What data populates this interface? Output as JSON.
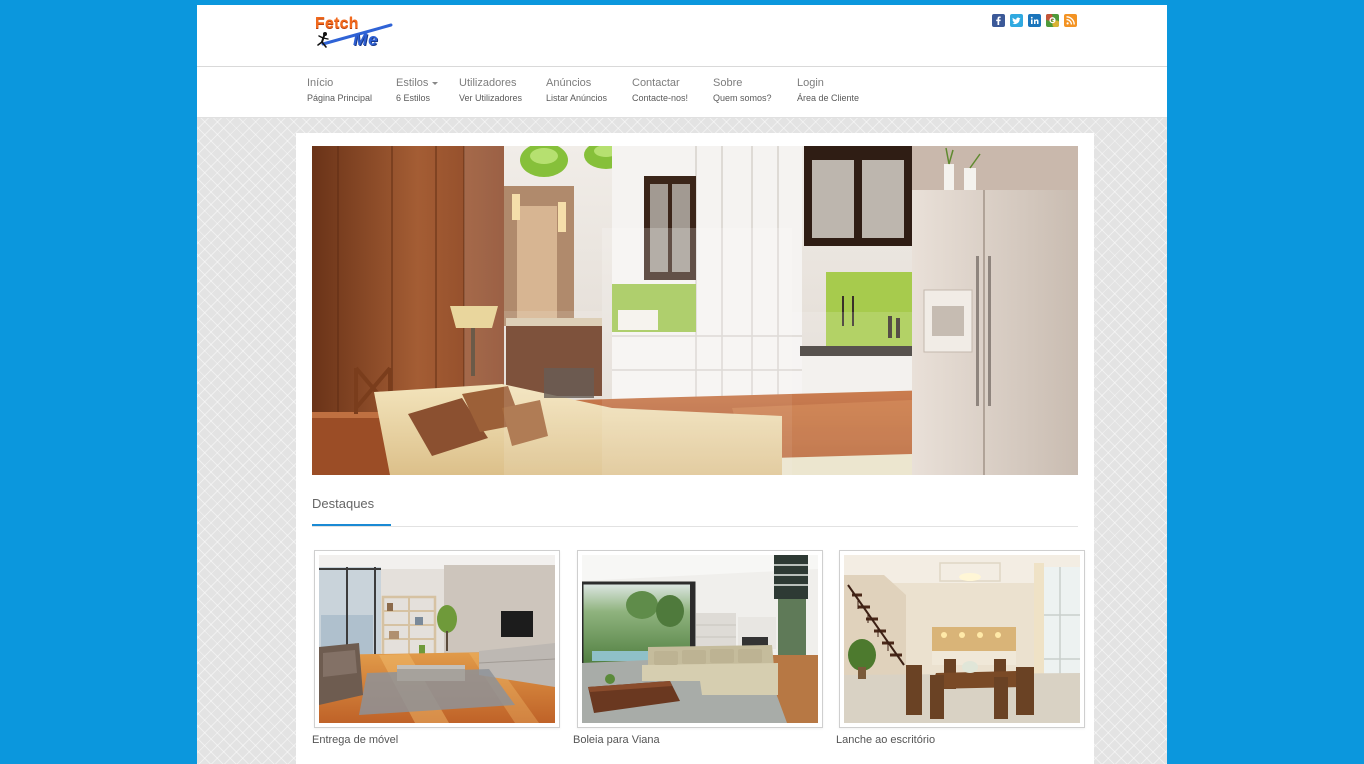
{
  "header": {
    "logo": {
      "word1": "Fetch",
      "word2": "Me"
    },
    "social_icons": [
      "facebook-icon",
      "twitter-icon",
      "linkedin-icon",
      "google-plus-icon",
      "rss-icon"
    ]
  },
  "nav": {
    "items": [
      {
        "label": "Início",
        "sub": "Página Principal"
      },
      {
        "label": "Estilos",
        "sub": "6 Estilos",
        "has_dropdown": true,
        "dropdown_icon": "caret-down-icon"
      },
      {
        "label": "Utilizadores",
        "sub": "Ver Utilizadores"
      },
      {
        "label": "Anúncios",
        "sub": "Listar Anúncios"
      },
      {
        "label": "Contactar",
        "sub": "Contacte-nos!"
      },
      {
        "label": "Sobre",
        "sub": "Quem somos?"
      },
      {
        "label": "Login",
        "sub": "Área de Cliente"
      }
    ]
  },
  "featured": {
    "heading": "Destaques",
    "items": [
      {
        "caption": "Entrega de móvel"
      },
      {
        "caption": "Boleia para Viana"
      },
      {
        "caption": "Lanche ao escritório"
      }
    ]
  },
  "colors": {
    "page_background": "#0b97dd",
    "accent": "#1a8ad4",
    "logo_orange": "#f2691c",
    "logo_blue": "#2d5fd3",
    "facebook": "#3b5998",
    "twitter": "#2fa9e0",
    "linkedin": "#1b75bb",
    "google_plus": "#4e9a3a",
    "rss": "#f39323"
  }
}
